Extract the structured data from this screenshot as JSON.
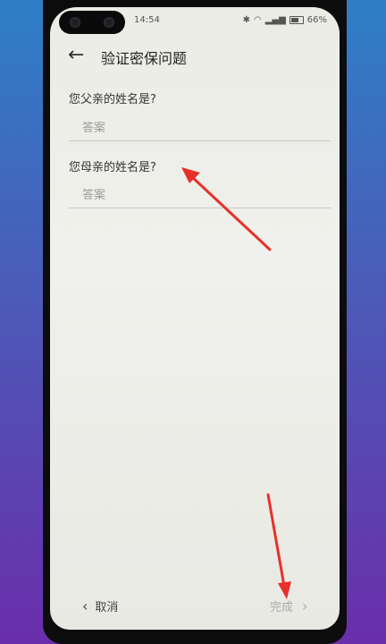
{
  "status": {
    "time": "14:54",
    "icons": [
      "bluetooth-icon",
      "wifi-icon",
      "signal-icon",
      "battery-icon"
    ],
    "battery": "66%"
  },
  "header": {
    "title": "验证密保问题"
  },
  "form": {
    "q1_label": "您父亲的姓名是?",
    "q1_placeholder": "答案",
    "q2_label": "您母亲的姓名是?",
    "q2_placeholder": "答案"
  },
  "footer": {
    "cancel_label": "取消",
    "finish_label": "完成"
  },
  "colors": {
    "annotation_arrow": "#e8302a",
    "background_top": "#2e7fc6",
    "background_bottom": "#6a2eaa"
  }
}
